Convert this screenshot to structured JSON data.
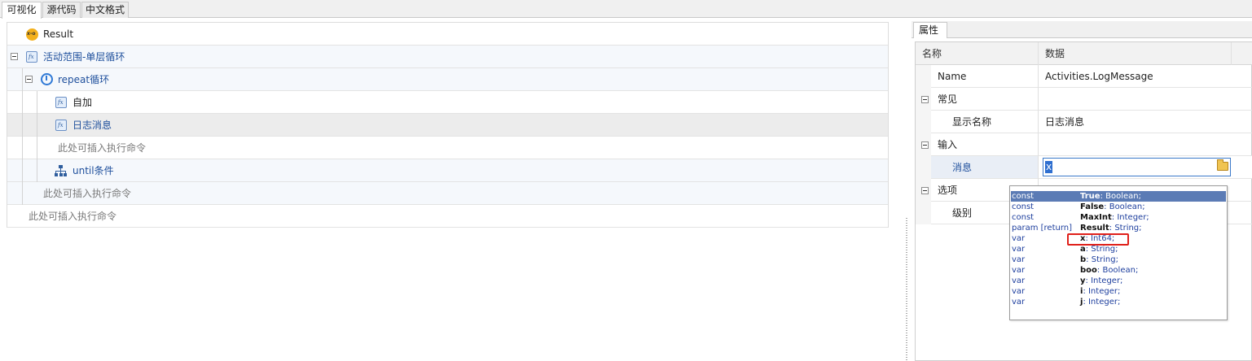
{
  "top_tabs": [
    {
      "label": "可视化",
      "active": true
    },
    {
      "label": "源代码",
      "active": false
    },
    {
      "label": "中文格式",
      "active": false
    }
  ],
  "tree": {
    "result": "Result",
    "scope": "活动范围-单层循环",
    "repeat": "repeat循环",
    "selfadd": "自加",
    "log_message": "日志消息",
    "insert_hint_1": "此处可插入执行命令",
    "until": "until条件",
    "insert_hint_2": "此处可插入执行命令",
    "insert_hint_3": "此处可插入执行命令"
  },
  "properties": {
    "tab_label": "属性",
    "col_name": "名称",
    "col_data": "数据",
    "name_label": "Name",
    "name_value": "Activities.LogMessage",
    "cat_common": "常见",
    "display_name_label": "显示名称",
    "display_name_value": "日志消息",
    "cat_input": "输入",
    "message_label": "消息",
    "message_value": "x",
    "cat_options": "选项",
    "level_label": "级别"
  },
  "autocomplete": [
    {
      "kind": "const",
      "name": "True",
      "type": ": Boolean;"
    },
    {
      "kind": "const",
      "name": "False",
      "type": ": Boolean;"
    },
    {
      "kind": "const",
      "name": "MaxInt",
      "type": ": Integer;"
    },
    {
      "kind": "param [return]",
      "name": "Result",
      "type": ": String;"
    },
    {
      "kind": "var",
      "name": "x",
      "type": ": Int64;"
    },
    {
      "kind": "var",
      "name": "a",
      "type": ": String;"
    },
    {
      "kind": "var",
      "name": "b",
      "type": ": String;"
    },
    {
      "kind": "var",
      "name": "boo",
      "type": ": Boolean;"
    },
    {
      "kind": "var",
      "name": "y",
      "type": ": Integer;"
    },
    {
      "kind": "var",
      "name": "i",
      "type": ": Integer;"
    },
    {
      "kind": "var",
      "name": "j",
      "type": ": Integer;"
    }
  ],
  "colors": {
    "accent_blue": "#1e4f9c",
    "selection": "#5b7bb5",
    "highlight_red": "#e0201a"
  }
}
